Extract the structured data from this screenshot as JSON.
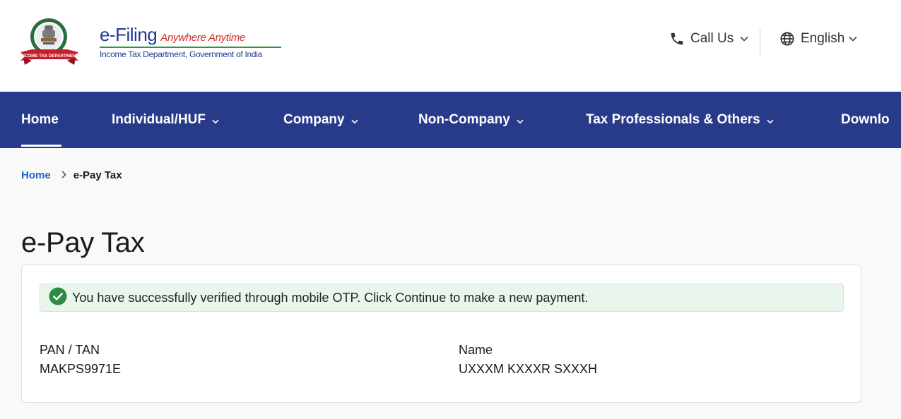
{
  "header": {
    "brand_main": "e-Filing",
    "brand_tagline": "Anywhere Anytime",
    "brand_subtitle": "Income Tax Department, Government of India",
    "emblem_ribbon_text": "INCOME TAX DEPARTMENT",
    "call_label": "Call Us",
    "language_label": "English"
  },
  "nav": {
    "items": [
      {
        "label": "Home"
      },
      {
        "label": "Individual/HUF"
      },
      {
        "label": "Company"
      },
      {
        "label": "Non-Company"
      },
      {
        "label": "Tax Professionals & Others"
      },
      {
        "label": "Downlo"
      }
    ]
  },
  "breadcrumb": {
    "home": "Home",
    "current": "e-Pay Tax"
  },
  "page": {
    "title": "e-Pay Tax"
  },
  "alert": {
    "message": "You have successfully verified through mobile OTP. Click Continue to make a new payment."
  },
  "details": {
    "pan_label": "PAN / TAN",
    "pan_value": "MAKPS9971E",
    "name_label": "Name",
    "name_value": "UXXXM KXXXR SXXXH"
  },
  "colors": {
    "nav_background": "#283a8a",
    "link": "#1f63c4",
    "success": "#2e8b47",
    "brand_blue": "#1f3a93",
    "brand_red": "#d02a2a"
  },
  "icons": [
    "govt-emblem-icon",
    "phone-icon",
    "globe-icon",
    "chevron-down-icon",
    "chevron-right-icon",
    "check-circle-icon"
  ]
}
